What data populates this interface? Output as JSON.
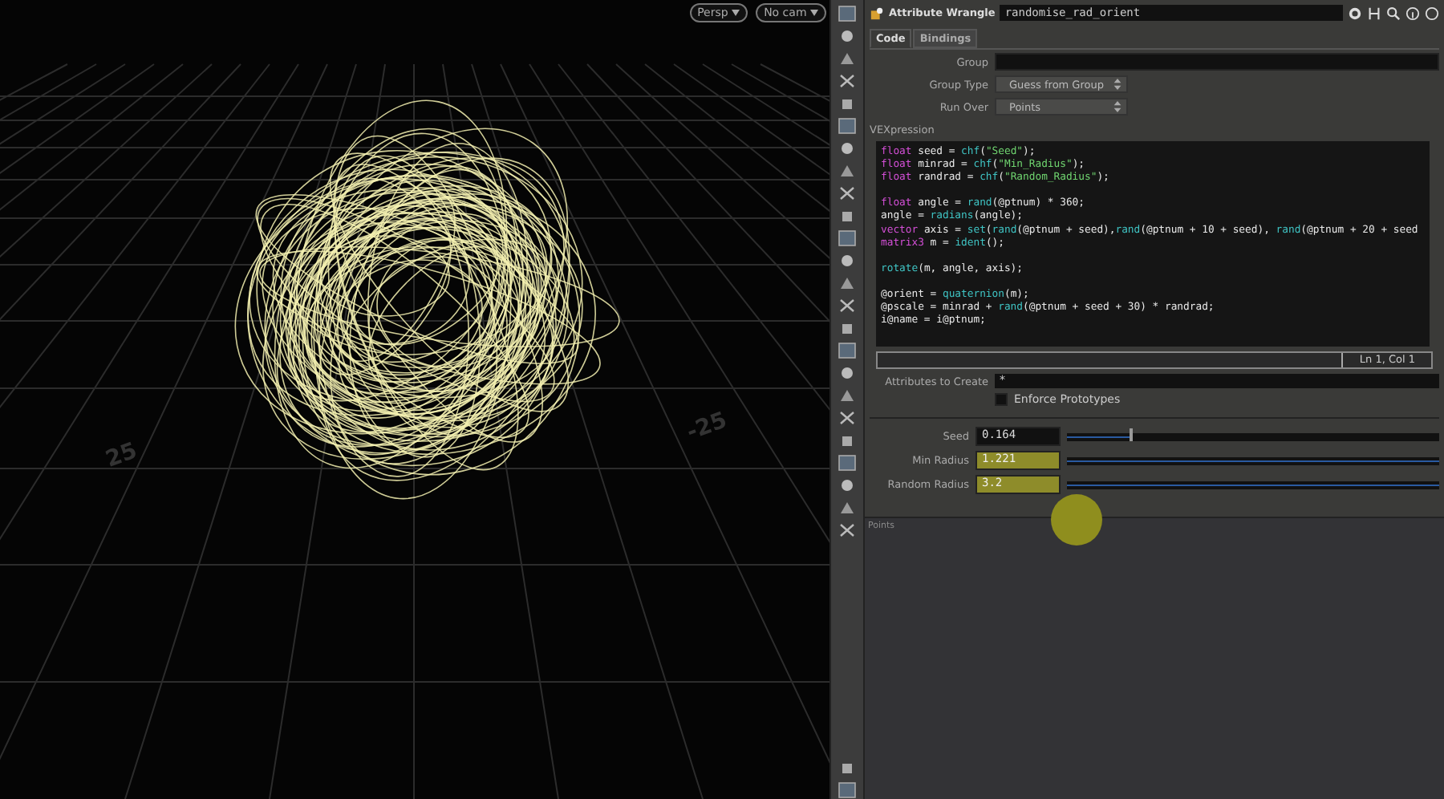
{
  "viewport": {
    "camera_menus": [
      "Persp",
      "No cam"
    ],
    "grid_labels": [
      "25",
      "-25"
    ]
  },
  "node": {
    "type": "Attribute Wrangle",
    "name": "randomise_rad_orient"
  },
  "tabs": [
    {
      "label": "Code",
      "selected": true
    },
    {
      "label": "Bindings",
      "selected": false
    }
  ],
  "params": [
    {
      "label": "Group",
      "kind": "field"
    },
    {
      "label": "Group Type",
      "kind": "menu",
      "value": "Guess from Group"
    },
    {
      "label": "Run Over",
      "kind": "menu",
      "value": "Points"
    }
  ],
  "editor": {
    "label": "VEXpression",
    "status": "Ln 1, Col 1",
    "lines": [
      {
        "kind": "code",
        "tokens": [
          {
            "text": "float",
            "kind": "type"
          },
          {
            "text": " seed = ",
            "kind": "plain"
          },
          {
            "text": "chf",
            "kind": "func"
          },
          {
            "text": "(",
            "kind": "plain"
          },
          {
            "text": "\"Seed\"",
            "kind": "str"
          },
          {
            "text": ");",
            "kind": "plain"
          }
        ]
      },
      {
        "kind": "code",
        "tokens": [
          {
            "text": "float",
            "kind": "type"
          },
          {
            "text": " minrad = ",
            "kind": "plain"
          },
          {
            "text": "chf",
            "kind": "func"
          },
          {
            "text": "(",
            "kind": "plain"
          },
          {
            "text": "\"Min_Radius\"",
            "kind": "str"
          },
          {
            "text": ");",
            "kind": "plain"
          }
        ]
      },
      {
        "kind": "code",
        "tokens": [
          {
            "text": "float",
            "kind": "type"
          },
          {
            "text": " randrad = ",
            "kind": "plain"
          },
          {
            "text": "chf",
            "kind": "func"
          },
          {
            "text": "(",
            "kind": "plain"
          },
          {
            "text": "\"Random_Radius\"",
            "kind": "str"
          },
          {
            "text": ");",
            "kind": "plain"
          }
        ]
      },
      {
        "kind": "blank"
      },
      {
        "kind": "code",
        "tokens": [
          {
            "text": "float",
            "kind": "type"
          },
          {
            "text": " angle = ",
            "kind": "plain"
          },
          {
            "text": "rand",
            "kind": "func"
          },
          {
            "text": "(@ptnum) * 360;",
            "kind": "plain"
          }
        ]
      },
      {
        "kind": "code",
        "tokens": [
          {
            "text": "angle = ",
            "kind": "plain"
          },
          {
            "text": "radians",
            "kind": "func"
          },
          {
            "text": "(angle);",
            "kind": "plain"
          }
        ]
      },
      {
        "kind": "code",
        "tokens": [
          {
            "text": "vector",
            "kind": "type"
          },
          {
            "text": " axis = ",
            "kind": "plain"
          },
          {
            "text": "set",
            "kind": "func"
          },
          {
            "text": "(",
            "kind": "plain"
          },
          {
            "text": "rand",
            "kind": "func"
          },
          {
            "text": "(@ptnum + seed),",
            "kind": "plain"
          },
          {
            "text": "rand",
            "kind": "func"
          },
          {
            "text": "(@ptnum + 10 + seed), ",
            "kind": "plain"
          },
          {
            "text": "rand",
            "kind": "func"
          },
          {
            "text": "(@ptnum + 20 + seed",
            "kind": "plain"
          }
        ]
      },
      {
        "kind": "code",
        "tokens": [
          {
            "text": "matrix3",
            "kind": "type"
          },
          {
            "text": " m = ",
            "kind": "plain"
          },
          {
            "text": "ident",
            "kind": "func"
          },
          {
            "text": "();",
            "kind": "plain"
          }
        ]
      },
      {
        "kind": "blank"
      },
      {
        "kind": "code",
        "tokens": [
          {
            "text": "rotate",
            "kind": "func"
          },
          {
            "text": "(m, angle, axis);",
            "kind": "plain"
          }
        ]
      },
      {
        "kind": "blank"
      },
      {
        "kind": "code",
        "tokens": [
          {
            "text": "@orient = ",
            "kind": "plain"
          },
          {
            "text": "quaternion",
            "kind": "func"
          },
          {
            "text": "(m);",
            "kind": "plain"
          }
        ]
      },
      {
        "kind": "code",
        "tokens": [
          {
            "text": "@pscale = minrad + ",
            "kind": "plain"
          },
          {
            "text": "rand",
            "kind": "func"
          },
          {
            "text": "(@ptnum + seed + 30) * randrad;",
            "kind": "plain"
          }
        ]
      },
      {
        "kind": "code",
        "tokens": [
          {
            "text": "i@name = i@ptnum;",
            "kind": "plain"
          }
        ]
      }
    ]
  },
  "attributes_to_create": {
    "label": "Attributes to Create",
    "value": "*"
  },
  "enforce_prototypes": {
    "label": "Enforce Prototypes",
    "checked": false
  },
  "sliders": [
    {
      "label": "Seed",
      "value": "0.164",
      "level": 0.17,
      "highlighted": false
    },
    {
      "label": "Min Radius",
      "value": "1.221",
      "level": 1,
      "highlighted": true
    },
    {
      "label": "Random Radius",
      "value": "3.2",
      "level": 1,
      "highlighted": true
    }
  ],
  "section_label": "Points"
}
